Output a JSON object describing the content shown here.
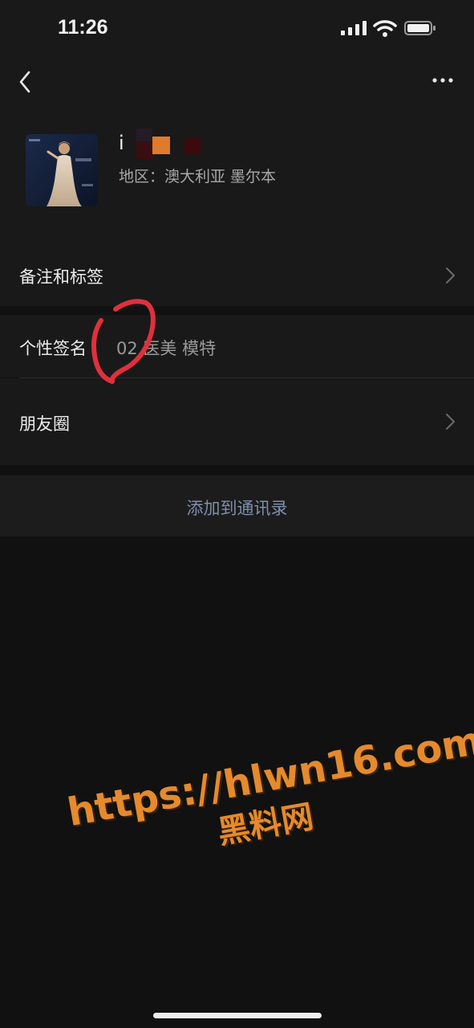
{
  "status_bar": {
    "time": "11:26",
    "signal_icon": "cellular-signal-icon",
    "wifi_icon": "wifi-icon",
    "battery_icon": "battery-icon"
  },
  "nav": {
    "back_icon": "chevron-left-icon",
    "more_icon": "ellipsis-icon"
  },
  "profile": {
    "name_visible": "𝗂",
    "region": "地区：澳大利亚 墨尔本"
  },
  "rows": {
    "remarks_label": "备注和标签",
    "signature_label": "个性签名",
    "signature_value": "02 医美 模特",
    "moments_label": "朋友圈"
  },
  "actions": {
    "add_contact_label": "添加到通讯录"
  },
  "watermark": {
    "url": "https://hlwn16.com",
    "site_name": "黑料网"
  },
  "colors": {
    "background": "#111111",
    "panel": "#191919",
    "link_blue": "#7d90ad",
    "watermark_orange": "#e58a2d",
    "annotation_red": "#e0303c"
  }
}
